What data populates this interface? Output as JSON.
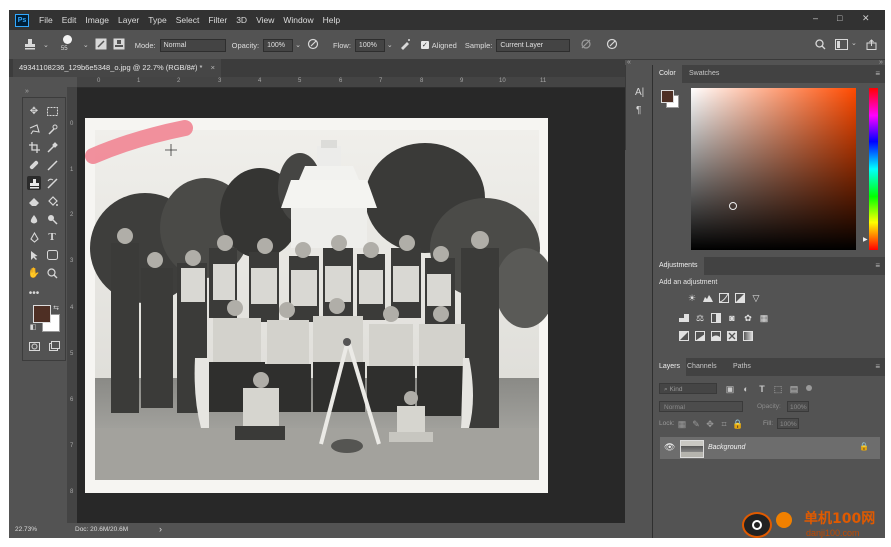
{
  "menubar": {
    "logo": "Ps",
    "items": [
      "File",
      "Edit",
      "Image",
      "Layer",
      "Type",
      "Select",
      "Filter",
      "3D",
      "View",
      "Window",
      "Help"
    ],
    "controls": [
      "–",
      "□",
      "✕"
    ]
  },
  "options_bar": {
    "brush_size": "55",
    "mode_label": "Mode:",
    "mode_value": "Normal",
    "opacity_label": "Opacity:",
    "opacity_value": "100%",
    "flow_label": "Flow:",
    "flow_value": "100%",
    "aligned_label": "Aligned",
    "sample_label": "Sample:",
    "sample_value": "Current Layer"
  },
  "document": {
    "tab_title": "49341108236_129b6e5348_o.jpg @ 22.7% (RGB/8#) *",
    "close": "×",
    "ruler_top": [
      "0",
      "1",
      "2",
      "3",
      "4",
      "5",
      "6",
      "7",
      "8",
      "9",
      "10",
      "11"
    ],
    "ruler_left": [
      "0",
      "1",
      "2",
      "3",
      "4",
      "5",
      "6",
      "7",
      "8"
    ]
  },
  "status": {
    "zoom": "22.73%",
    "doc": "Doc: 20.6M/20.6M",
    "arrow": "›"
  },
  "color_panel": {
    "tabs": [
      "Color",
      "Swatches"
    ],
    "fg": "#4e2f24",
    "bg": "#ffffff",
    "hue": "#ff4a00"
  },
  "adjustments_panel": {
    "tab": "Adjustments",
    "subtitle": "Add an adjustment"
  },
  "layers_panel": {
    "tabs": [
      "Layers",
      "Channels",
      "Paths"
    ],
    "kind_label": "Kind",
    "blend_mode": "Normal",
    "opacity_label": "Opacity:",
    "opacity_value": "100%",
    "lock_label": "Lock:",
    "fill_label": "Fill:",
    "fill_value": "100%",
    "layer_name": "Background"
  },
  "watermark": {
    "text": "单机100网",
    "url": "danji100.com"
  },
  "colors": {
    "ps_dark": "#323232",
    "ps_panel": "#535353",
    "pink_stroke": "#f08a98"
  }
}
